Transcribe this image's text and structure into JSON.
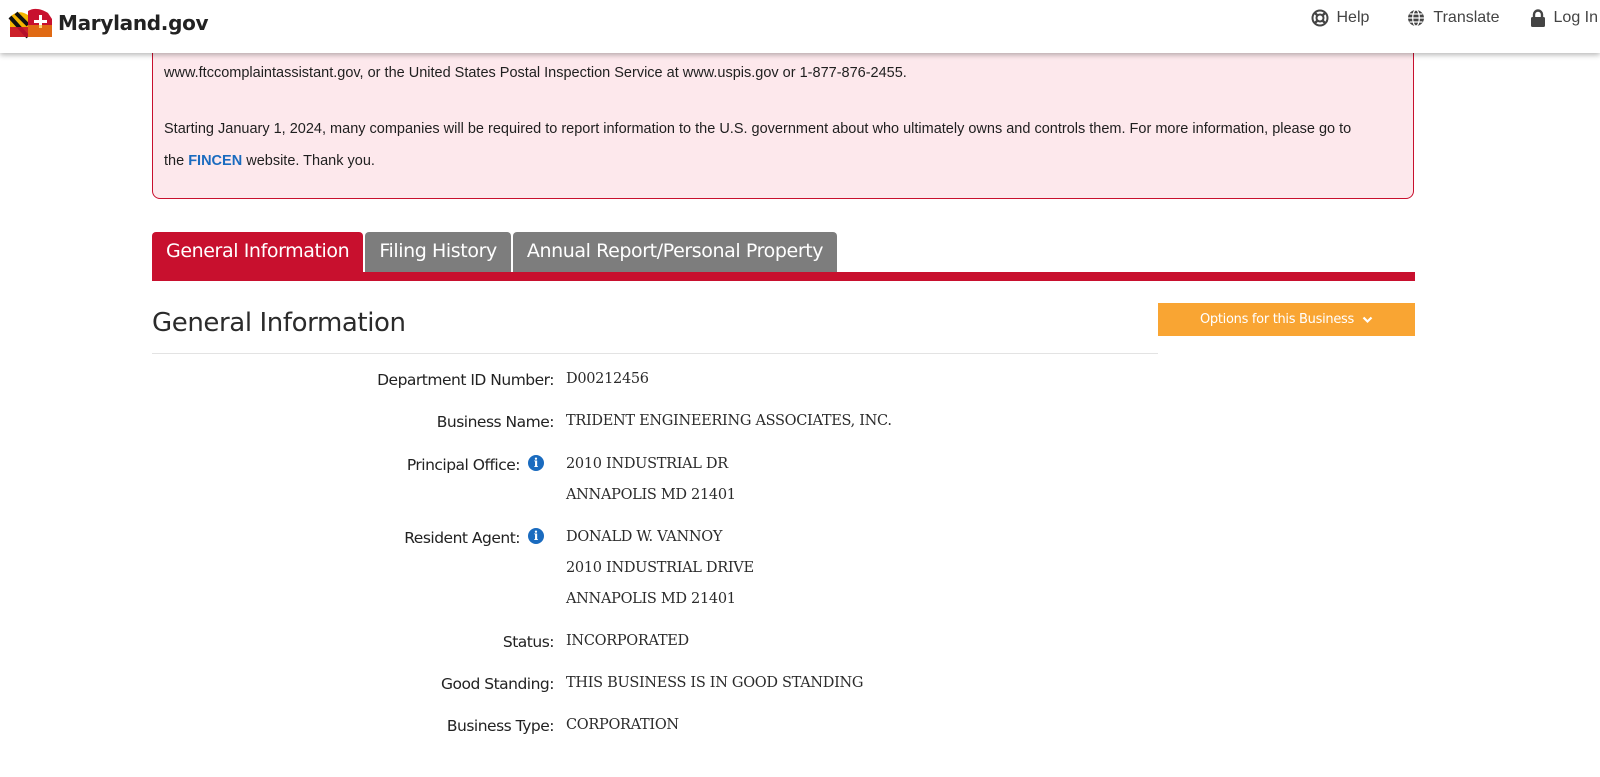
{
  "header": {
    "brand": "Maryland.gov",
    "help_label": "Help",
    "translate_label": "Translate",
    "login_label": "Log In"
  },
  "alert": {
    "line1": "www.ftccomplaintassistant.gov, or the United States Postal Inspection Service at www.uspis.gov or 1-877-876-2455.",
    "line2": "Starting January 1, 2024, many companies will be required to report information to the U.S. government about who ultimately owns and controls them. For more information, please go to",
    "line3_prefix": "the",
    "link_text": "FINCEN",
    "line3_suffix": "website.  Thank you."
  },
  "tabs": [
    {
      "label": "General Information",
      "active": true
    },
    {
      "label": "Filing History",
      "active": false
    },
    {
      "label": "Annual Report/Personal Property",
      "active": false
    }
  ],
  "section": {
    "title": "General Information",
    "options_label": "Options for this Business"
  },
  "details": {
    "department_id": {
      "label": "Department ID Number:",
      "value": "D00212456"
    },
    "business_name": {
      "label": "Business Name:",
      "value": "TRIDENT ENGINEERING ASSOCIATES, INC."
    },
    "principal_office": {
      "label": "Principal Office:",
      "lines": [
        "2010 INDUSTRIAL DR",
        "ANNAPOLIS MD 21401"
      ]
    },
    "resident_agent": {
      "label": "Resident Agent:",
      "lines": [
        "DONALD W. VANNOY",
        "2010 INDUSTRIAL DRIVE",
        "ANNAPOLIS MD 21401"
      ]
    },
    "status": {
      "label": "Status:",
      "value": "INCORPORATED"
    },
    "good_standing": {
      "label": "Good Standing:",
      "value": "THIS BUSINESS IS IN GOOD STANDING"
    },
    "business_type": {
      "label": "Business Type:",
      "value": "CORPORATION"
    }
  },
  "colors": {
    "brand_red": "#c8102e",
    "tab_inactive": "#7d7d7d",
    "options_orange": "#f9a533",
    "alert_bg": "#fde8ec",
    "link_blue": "#1a6bbf"
  }
}
